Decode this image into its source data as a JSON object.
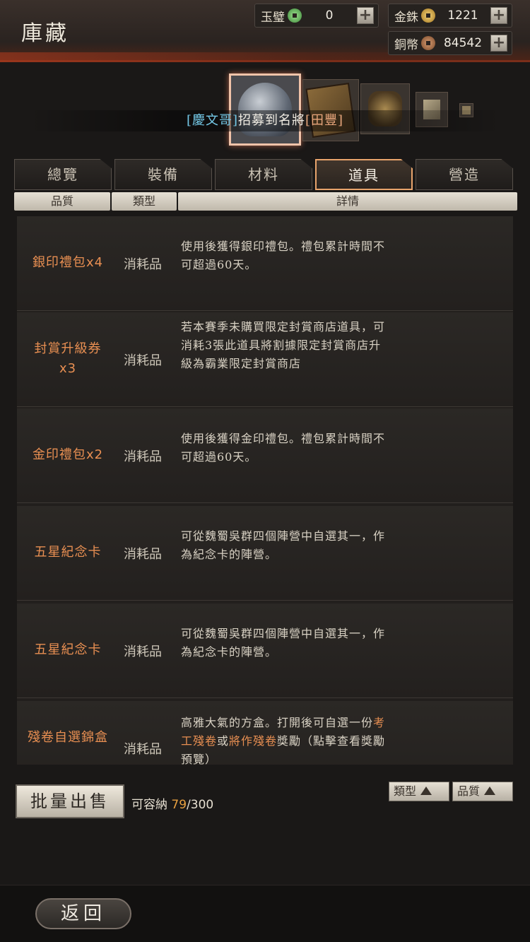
{
  "header": {
    "title": "庫藏"
  },
  "resources": [
    {
      "label": "玉璧",
      "icon": "jade-coin-icon",
      "value": "0"
    },
    {
      "label": "金銖",
      "icon": "gold-coin-icon",
      "value": "1221"
    },
    {
      "label": "銅幣",
      "icon": "copper-coin-icon",
      "value": "84542"
    }
  ],
  "recruit_banner": {
    "player": "[慶文哥]",
    "text": "招募到名將",
    "general": "[田豐]"
  },
  "tabs": [
    {
      "label": "總覽",
      "active": false
    },
    {
      "label": "裝備",
      "active": false
    },
    {
      "label": "材料",
      "active": false
    },
    {
      "label": "道具",
      "active": true
    },
    {
      "label": "營造",
      "active": false
    }
  ],
  "columns": {
    "quality": "品質",
    "type": "類型",
    "detail": "詳情"
  },
  "items": [
    {
      "name": "銀印禮包",
      "qty": "x4",
      "type": "消耗品",
      "desc": "使用後獲得銀印禮包。禮包累計時間不可超過60天。"
    },
    {
      "name": "封賞升級券",
      "qty": "x3",
      "type": "消耗品",
      "desc": "若本賽季未購買限定封賞商店道具，可消耗3張此道具將割據限定封賞商店升級為霸業限定封賞商店"
    },
    {
      "name": "金印禮包",
      "qty": "x2",
      "type": "消耗品",
      "desc": "使用後獲得金印禮包。禮包累計時間不可超過60天。"
    },
    {
      "name": "五星紀念卡",
      "qty": "",
      "type": "消耗品",
      "desc": "可從魏蜀吳群四個陣營中自選其一，作為紀念卡的陣營。"
    },
    {
      "name": "五星紀念卡",
      "qty": "",
      "type": "消耗品",
      "desc": "可從魏蜀吳群四個陣營中自選其一，作為紀念卡的陣營。"
    },
    {
      "name": "殘卷自選錦盒",
      "qty": "",
      "type": "消耗品",
      "desc_a": "高雅大氣的方盒。打開後可自選一份",
      "desc_h1": "考工殘卷",
      "desc_b": "或",
      "desc_h2": "將作殘卷",
      "desc_c": "獎勵（點擊查看獎勵預覽）"
    }
  ],
  "bottom": {
    "batch_sell": "批量出售",
    "capacity_label": "可容納",
    "capacity_used": "79",
    "capacity_total": "/300",
    "sort_type": "類型",
    "sort_quality": "品質"
  },
  "footer": {
    "back": "返回"
  }
}
